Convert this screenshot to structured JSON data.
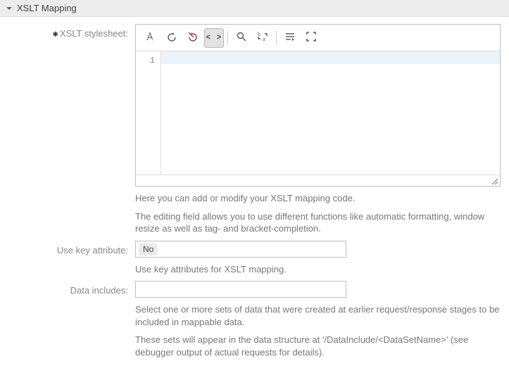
{
  "section": {
    "title": "XSLT Mapping"
  },
  "fields": {
    "stylesheet": {
      "label": "XSLT stylesheet:",
      "required_marker": "✱",
      "gutter_line": "1",
      "value": "",
      "help1": "Here you can add or modify your XSLT mapping code.",
      "help2": "The editing field allows you to use different functions like automatic formatting, window resize as well as tag- and bracket-completion."
    },
    "use_key": {
      "label": "Use key attribute:",
      "value": "No",
      "help": "Use key attributes for XSLT mapping."
    },
    "data_includes": {
      "label": "Data includes:",
      "value": "",
      "help1": "Select one or more sets of data that were created at earlier request/response stages to be included in mappable data.",
      "help2": "These sets will appear in the data structure at '/DataInclude/<DataSetName>' (see debugger output of actual requests for details)."
    }
  },
  "toolbar": {
    "icons": [
      "format",
      "undo",
      "redo",
      "toggle-tags",
      "search",
      "replace",
      "wrap",
      "fullscreen"
    ],
    "code_label": "< >"
  }
}
